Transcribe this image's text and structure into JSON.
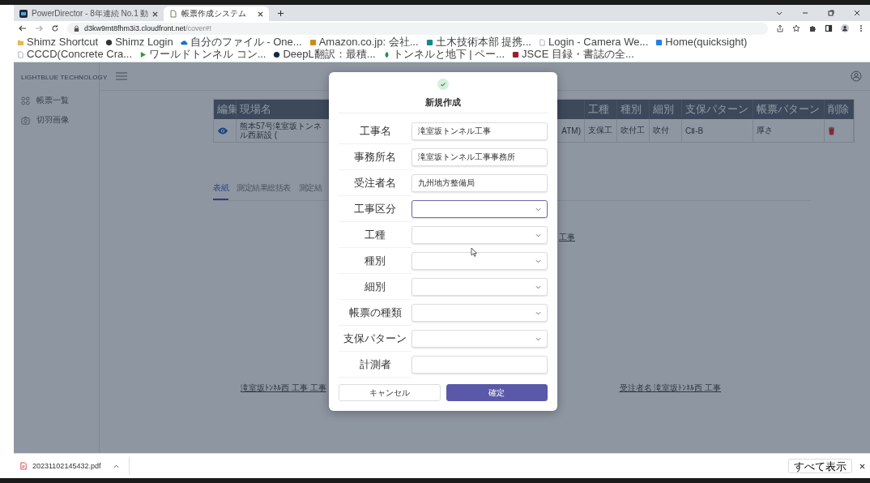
{
  "browser": {
    "tabs": [
      {
        "title": "PowerDirector - 8年連続 No.1 動",
        "selected": false
      },
      {
        "title": "帳票作成システム",
        "selected": true
      }
    ],
    "address": {
      "host": "d3kw9mt8fhm3i3.cloudfront.net",
      "path": "/cover#!"
    },
    "bookmarks": [
      {
        "label": "Shimz Shortcut",
        "kind": "folder"
      },
      {
        "label": "Shimz Login",
        "kind": "globe"
      },
      {
        "label": "自分のファイル - One...",
        "kind": "cloud"
      },
      {
        "label": "Amazon.co.jp: 会社...",
        "kind": "amazon"
      },
      {
        "label": "土木技術本部 提携...",
        "kind": "sharepoint"
      },
      {
        "label": "Login - Camera We...",
        "kind": "page"
      },
      {
        "label": "Home(quicksight)",
        "kind": "chart"
      },
      {
        "label": "CCCD(Concrete Cra...",
        "kind": "page"
      },
      {
        "label": "ワールドトンネル コン...",
        "kind": "play"
      },
      {
        "label": "DeepL翻訳：最積...",
        "kind": "deepl"
      },
      {
        "label": "トンネルと地下 | ペー...",
        "kind": "leaf"
      },
      {
        "label": "JSCE 目録・書誌の全...",
        "kind": "jsce"
      }
    ]
  },
  "app": {
    "logo": "LIGHTBLUE TECHNOLOGY",
    "sidebar": {
      "items": [
        {
          "label": "帳票一覧",
          "kind": "grid"
        },
        {
          "label": "切羽画像",
          "kind": "camera"
        }
      ]
    },
    "table": {
      "columns": [
        "編集",
        "現場名",
        "工種",
        "種別",
        "細別",
        "支保パターン",
        "帳票パターン",
        "削除"
      ],
      "rows": [
        {
          "name_parts": [
            "熊本57号滝室坂トンネル西新設 (",
            "ATM)"
          ],
          "work_type": "支保工",
          "category": "吹付工",
          "subcategory": "吹付",
          "support_pattern": "CⅡ-B",
          "report_pattern": "厚さ"
        }
      ]
    },
    "tabs": [
      {
        "label": "表紙",
        "selected": true
      },
      {
        "label": "測定結果総括表",
        "selected": false
      },
      {
        "label": "測定結",
        "selected": false
      }
    ],
    "links": [
      {
        "label": "工事",
        "kind": "middle"
      },
      {
        "label": "滝室坂ﾄﾝﾈﾙ西 工事 工事",
        "kind": "left"
      },
      {
        "label": "受注者名 滝室坂ﾄﾝﾈﾙ西 工事",
        "kind": "right"
      }
    ]
  },
  "modal": {
    "title": "新規作成",
    "fields": [
      {
        "label": "工事名",
        "kind": "text",
        "value": "滝室坂トンネル工事",
        "focused": false
      },
      {
        "label": "事務所名",
        "kind": "text",
        "value": "滝室坂トンネル工事事務所",
        "focused": false
      },
      {
        "label": "受注者名",
        "kind": "text",
        "value": "九州地方整備局",
        "focused": false
      },
      {
        "label": "工事区分",
        "kind": "select",
        "focused": true
      },
      {
        "label": "工種",
        "kind": "select",
        "focused": false
      },
      {
        "label": "種別",
        "kind": "select",
        "focused": false
      },
      {
        "label": "細別",
        "kind": "select",
        "focused": false
      },
      {
        "label": "帳票の種類",
        "kind": "select",
        "focused": false
      },
      {
        "label": "支保パターン",
        "kind": "select",
        "focused": false
      },
      {
        "label": "計測者",
        "kind": "text",
        "focused": false
      }
    ],
    "buttons": [
      {
        "label": "キャンセル",
        "kind": "secondary"
      },
      {
        "label": "確定",
        "kind": "primary"
      }
    ]
  },
  "download_bar": {
    "file": "20231102145432.pdf",
    "show_all": "すべて表示"
  }
}
